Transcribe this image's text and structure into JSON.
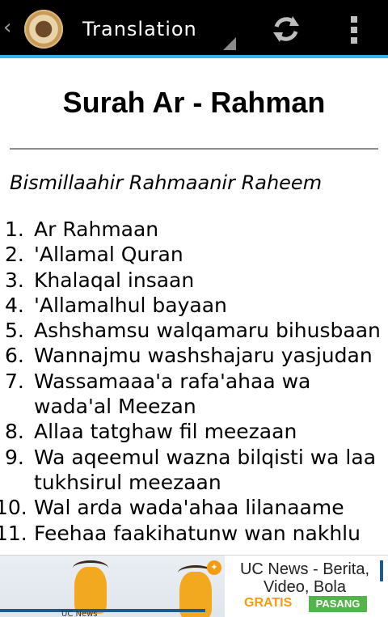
{
  "actionbar": {
    "title": "Translation",
    "app_icon": "quran-emblem-icon",
    "actions": [
      "refresh-icon",
      "overflow-menu-icon"
    ],
    "accent_color": "#33b5e5"
  },
  "content": {
    "surah_title": "Surah Ar - Rahman",
    "bismillah": "Bismillaahir Rahmaanir Raheem",
    "verses": [
      {
        "num": "1.",
        "text": "Ar Rahmaan"
      },
      {
        "num": "2.",
        "text": "'Allamal Quran"
      },
      {
        "num": "3.",
        "text": "Khalaqal insaan"
      },
      {
        "num": "4.",
        "text": "'Allamalhul bayaan"
      },
      {
        "num": "5.",
        "text": "Ashshamsu walqamaru bihusbaan"
      },
      {
        "num": "6.",
        "text": "Wannajmu washshajaru yasjudan"
      },
      {
        "num": "7.",
        "text": "Wassamaaa'a rafa'ahaa wa wada'al Meezan"
      },
      {
        "num": "8.",
        "text": "Allaa tatghaw fil meezaan"
      },
      {
        "num": "9.",
        "text": "Wa aqeemul wazna bilqisti wa laa tukhsirul meezaan"
      },
      {
        "num": "10.",
        "text": "Wal arda wada'ahaa lilanaame"
      },
      {
        "num": "11.",
        "text": "Feehaa faakihatunw wan nakhlu"
      }
    ]
  },
  "ad": {
    "headline": "UC News - Berita, Video, Bola",
    "gratis": "GRATIS",
    "install": "PASANG",
    "banner_caption": "UC News",
    "gratis_color": "#f39c12",
    "install_color": "#53b44b"
  }
}
